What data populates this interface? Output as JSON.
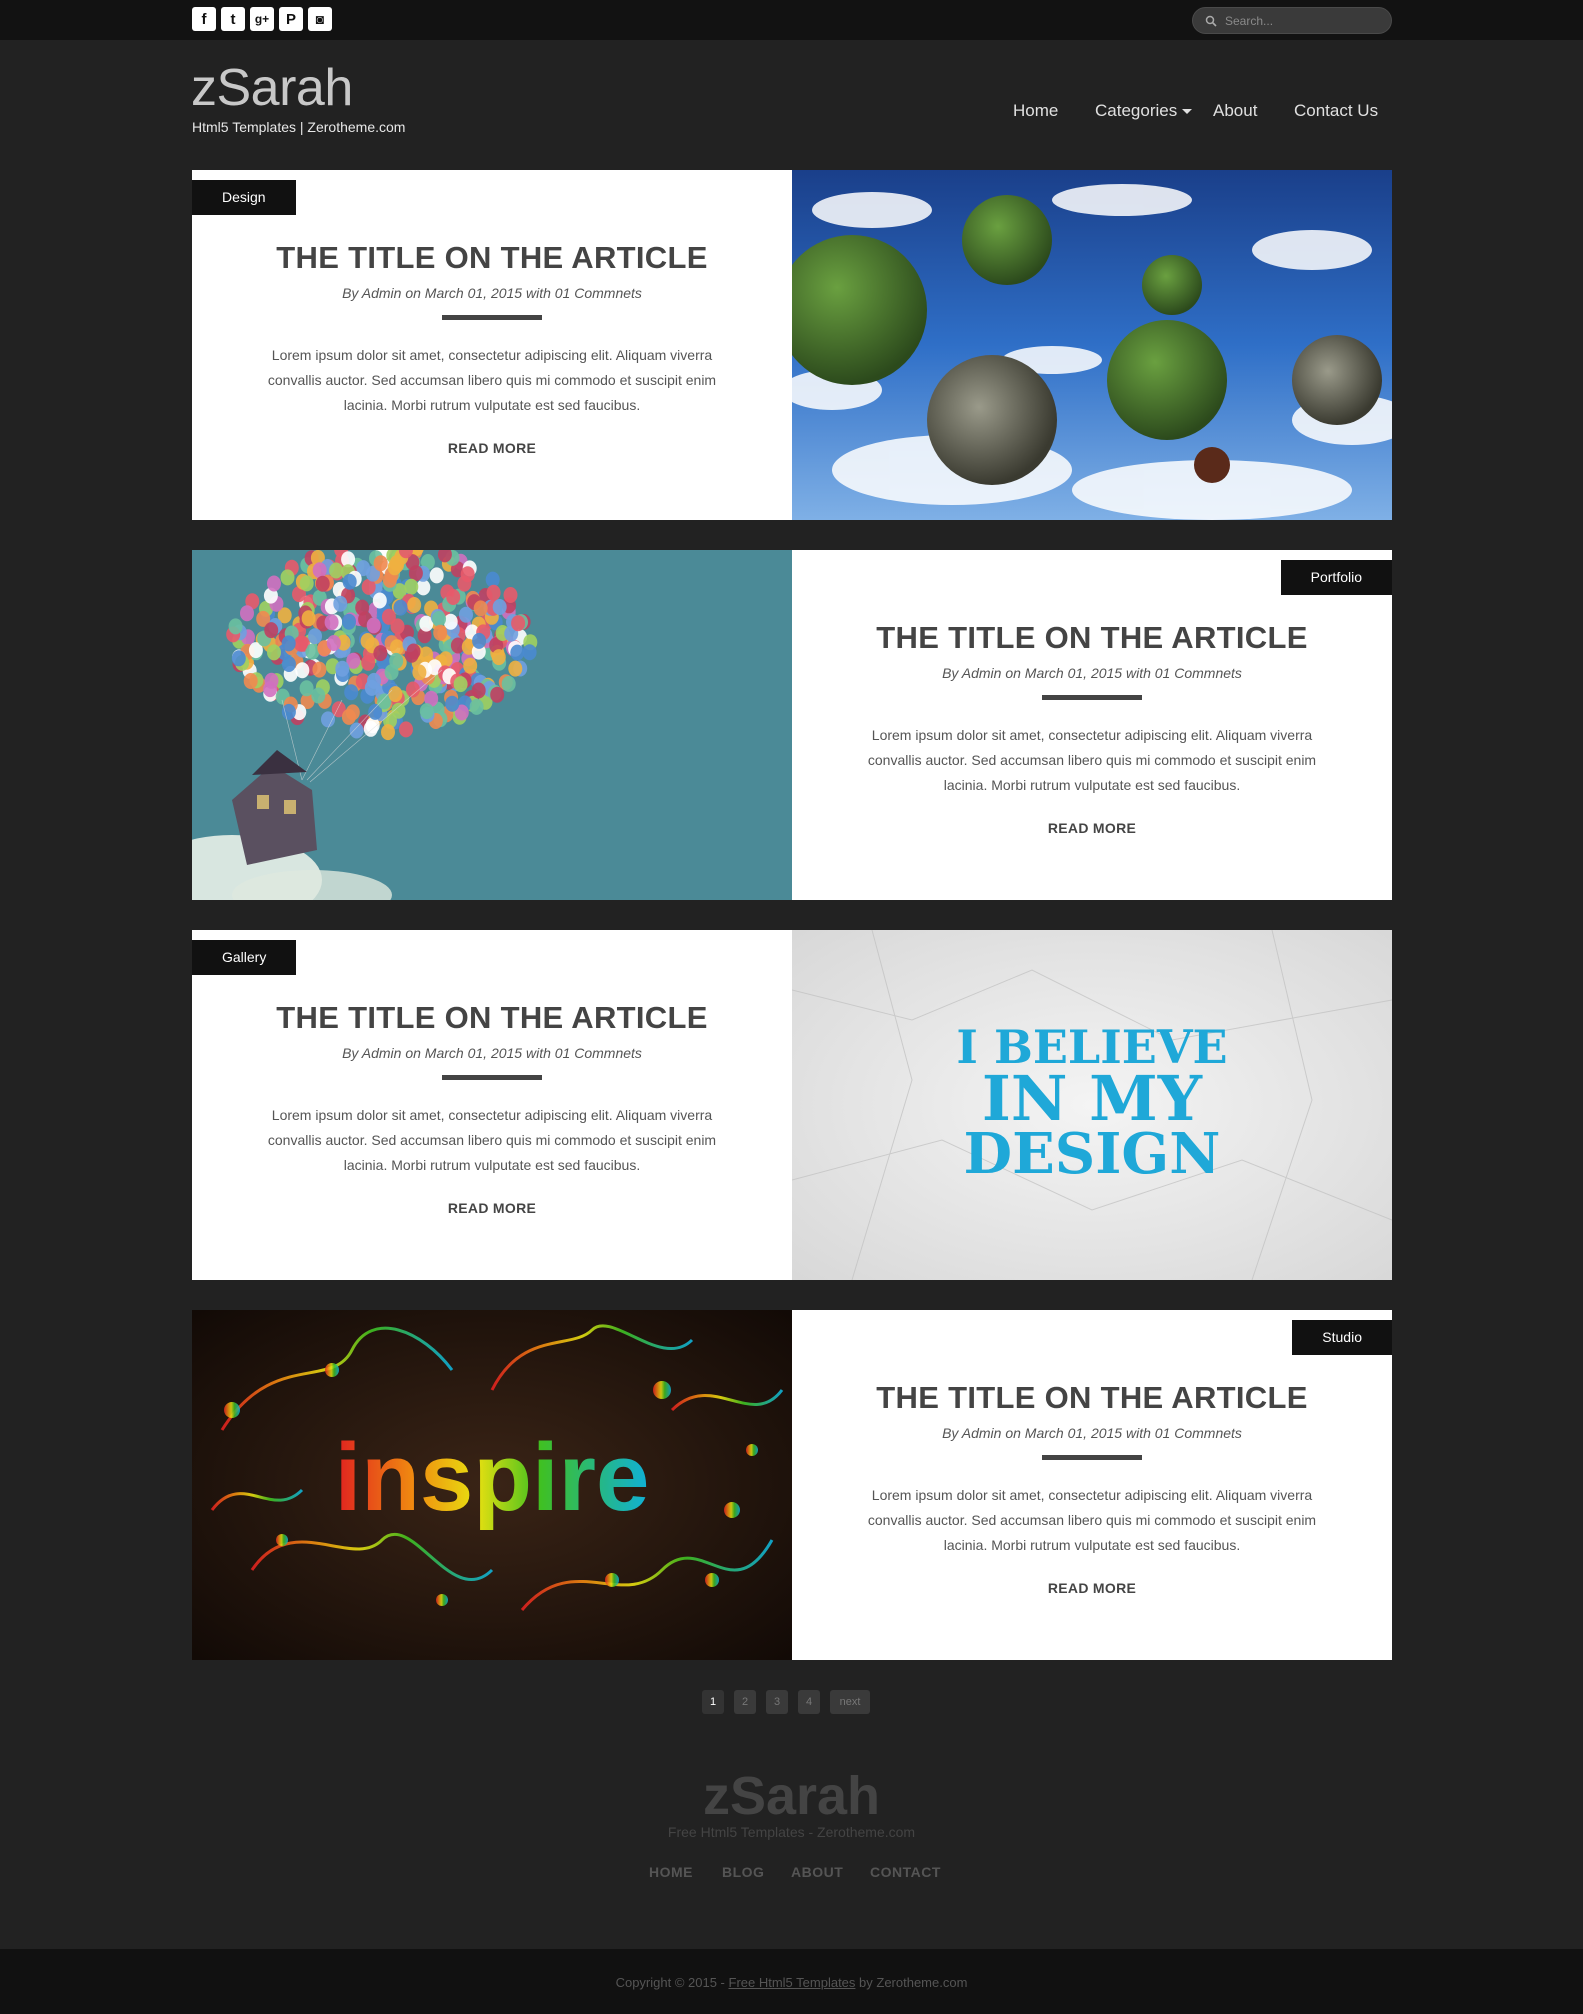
{
  "social": [
    {
      "icon": "facebook-icon",
      "glyph": "f"
    },
    {
      "icon": "twitter-icon",
      "glyph": "t"
    },
    {
      "icon": "google-plus-icon",
      "glyph": "g+"
    },
    {
      "icon": "pinterest-icon",
      "glyph": "P"
    },
    {
      "icon": "instagram-icon",
      "glyph": "◙"
    }
  ],
  "search": {
    "placeholder": "Search..."
  },
  "header": {
    "logo": "zSarah",
    "tagline": "Html5 Templates | Zerotheme.com"
  },
  "nav": {
    "home": "Home",
    "categories": "Categories",
    "about": "About",
    "contact": "Contact Us"
  },
  "articles": [
    {
      "tag": "Design",
      "title": "THE TITLE ON THE ARTICLE",
      "meta": "By Admin on March 01, 2015 with 01 Commnets",
      "excerpt": "Lorem ipsum dolor sit amet, consectetur adipiscing elit. Aliquam viverra convallis auctor. Sed accumsan libero quis mi commodo et suscipit enim lacinia. Morbi rutrum vulputate est sed faucibus.",
      "readmore": "READ MORE",
      "image": "floating-islands"
    },
    {
      "tag": "Portfolio",
      "title": "THE TITLE ON THE ARTICLE",
      "meta": "By Admin on March 01, 2015 with 01 Commnets",
      "excerpt": "Lorem ipsum dolor sit amet, consectetur adipiscing elit. Aliquam viverra convallis auctor. Sed accumsan libero quis mi commodo et suscipit enim lacinia. Morbi rutrum vulputate est sed faucibus.",
      "readmore": "READ MORE",
      "image": "balloon-house"
    },
    {
      "tag": "Gallery",
      "title": "THE TITLE ON THE ARTICLE",
      "meta": "By Admin on March 01, 2015 with 01 Commnets",
      "excerpt": "Lorem ipsum dolor sit amet, consectetur adipiscing elit. Aliquam viverra convallis auctor. Sed accumsan libero quis mi commodo et suscipit enim lacinia. Morbi rutrum vulputate est sed faucibus.",
      "readmore": "READ MORE",
      "image": "i-believe-in-my-design",
      "image_text": [
        "I BELIEVE",
        "IN MY",
        "DESIGN"
      ]
    },
    {
      "tag": "Studio",
      "title": "THE TITLE ON THE ARTICLE",
      "meta": "By Admin on March 01, 2015 with 01 Commnets",
      "excerpt": "Lorem ipsum dolor sit amet, consectetur adipiscing elit. Aliquam viverra convallis auctor. Sed accumsan libero quis mi commodo et suscipit enim lacinia. Morbi rutrum vulputate est sed faucibus.",
      "readmore": "READ MORE",
      "image": "inspire",
      "image_text": "inspire"
    }
  ],
  "pagination": {
    "pages": [
      "1",
      "2",
      "3",
      "4"
    ],
    "next": "next",
    "current": "1"
  },
  "footer": {
    "logo": "zSarah",
    "tagline": "Free Html5 Templates - Zerotheme.com",
    "nav": [
      "HOME",
      "BLOG",
      "ABOUT",
      "CONTACT"
    ],
    "copyright_prefix": "Copyright © 2015 - ",
    "copyright_link": "Free Html5 Templates",
    "copyright_suffix": " by Zerotheme.com"
  }
}
